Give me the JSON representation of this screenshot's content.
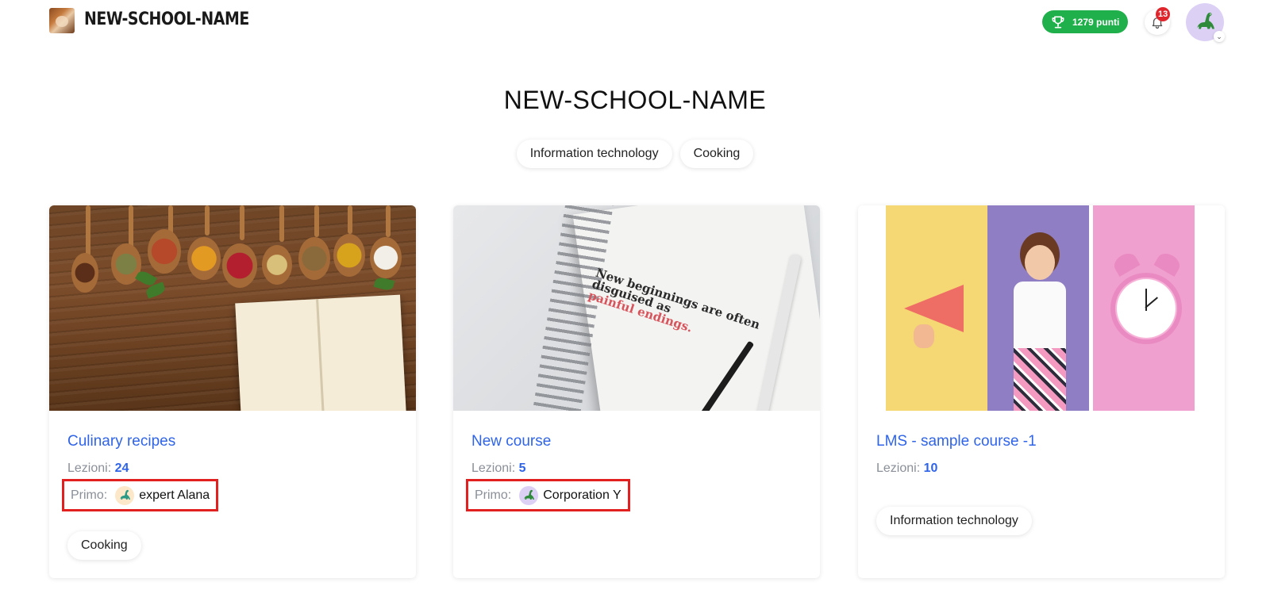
{
  "header": {
    "brand": "NEW-SCHOOL-NAME",
    "points_label": "1279 punti",
    "notifications_count": "13"
  },
  "main": {
    "title": "NEW-SCHOOL-NAME",
    "filters": [
      "Information technology",
      "Cooking"
    ]
  },
  "courses": [
    {
      "title": "Culinary recipes",
      "lessons_label": "Lezioni:",
      "lessons": "24",
      "first_label": "Primo:",
      "first_name": "expert Alana",
      "tag": "Cooking",
      "image_quote_line1": "",
      "avatar_bg": "#fde7c9"
    },
    {
      "title": "New course",
      "lessons_label": "Lezioni:",
      "lessons": "5",
      "first_label": "Primo:",
      "first_name": "Corporation Y",
      "image_quote_line1": "New beginnings are often",
      "image_quote_line2": "disguised as",
      "image_quote_line3": "painful endings.",
      "avatar_bg": "#dcd0f5"
    },
    {
      "title": "LMS - sample course -1",
      "lessons_label": "Lezioni:",
      "lessons": "10",
      "tag": "Information technology"
    }
  ],
  "colors": {
    "accent": "#2f64e8",
    "points_bg": "#20b04b",
    "badge_bg": "#e0262d",
    "highlight_border": "#e32020"
  },
  "icons": {
    "points": "trophy-icon",
    "notifications": "bell-icon",
    "avatar": "dinosaur-icon",
    "dropdown": "chevron-down-icon"
  }
}
